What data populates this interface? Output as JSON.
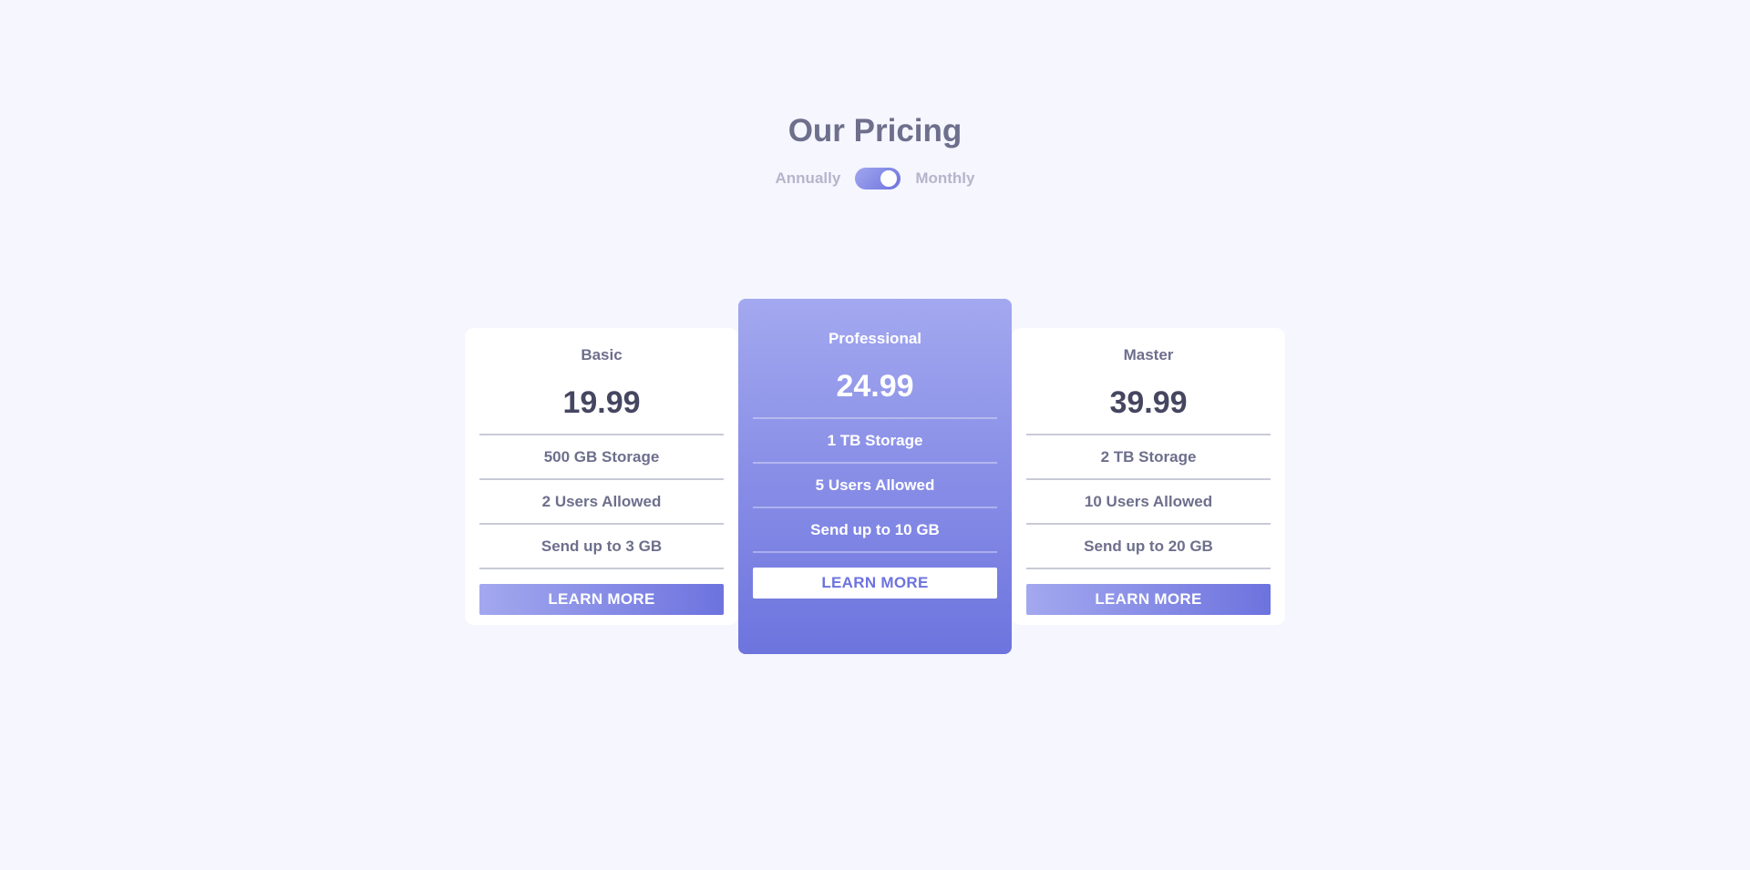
{
  "header": {
    "title": "Our Pricing",
    "toggle": {
      "left_label": "Annually",
      "right_label": "Monthly",
      "selected": "Monthly"
    }
  },
  "plans": [
    {
      "name": "Basic",
      "price": "19.99",
      "features": [
        "500 GB Storage",
        "2 Users Allowed",
        "Send up to 3 GB"
      ],
      "button_label": "LEARN MORE"
    },
    {
      "name": "Professional",
      "price": "24.99",
      "features": [
        "1 TB Storage",
        "5 Users Allowed",
        "Send up to 10 GB"
      ],
      "button_label": "LEARN MORE"
    },
    {
      "name": "Master",
      "price": "39.99",
      "features": [
        "2 TB Storage",
        "10 Users Allowed",
        "Send up to 20 GB"
      ],
      "button_label": "LEARN MORE"
    }
  ],
  "colors": {
    "background": "#f5f6fe",
    "accent_light": "#a3a8ef",
    "accent_dark": "#6d73de",
    "heading_text": "#6d6f8c",
    "price_text": "#454660",
    "muted_text": "#b5b5cb"
  }
}
